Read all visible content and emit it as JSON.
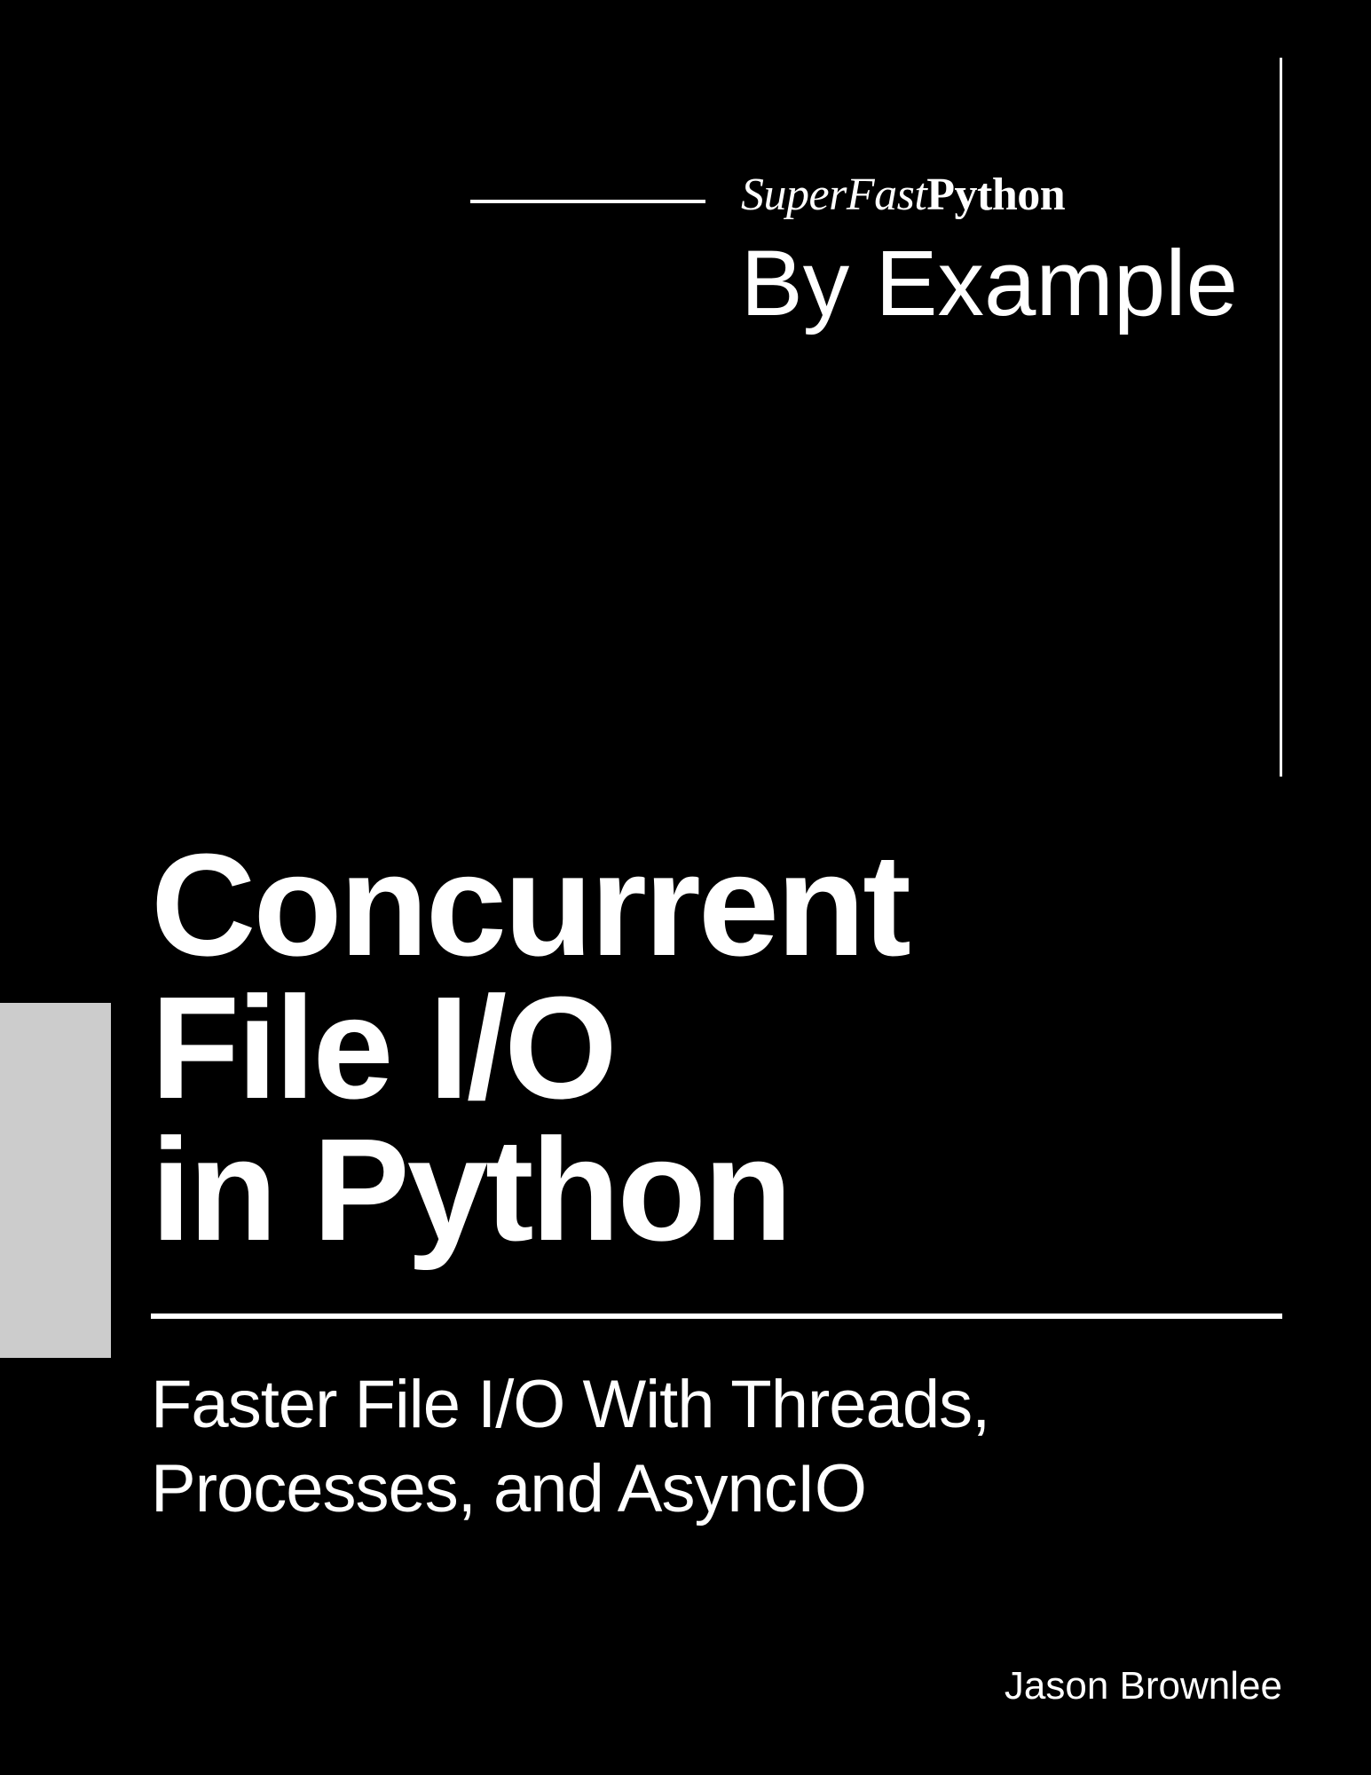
{
  "brand_italic": "SuperFast",
  "brand_bold": "Python",
  "by_example": "By Example",
  "title_line1": "Concurrent",
  "title_line2": "File I/O",
  "title_line3": "in Python",
  "subtitle": "Faster File I/O With Threads, Processes, and AsyncIO",
  "author": "Jason Brownlee"
}
